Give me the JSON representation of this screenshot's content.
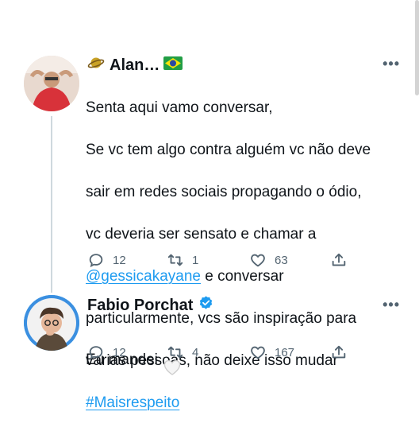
{
  "tweets": [
    {
      "author": "Alan…",
      "body_lines": [
        "Senta aqui vamo conversar,",
        "Se vc tem algo contra alguém vc não deve",
        "sair em redes sociais propagando o ódio,",
        "vc deveria ser sensato e chamar a"
      ],
      "mention": "@gessicakayane",
      "after_mention": " e conversar",
      "body_lines_2": [
        "particularmente, vcs são inspiração para",
        "varias pessoas, não deixe isso mudar"
      ],
      "hashtag": "#Maisrespeito",
      "replies": "12",
      "retweets": "1",
      "likes": "63",
      "icons": [
        "saturn-emoji-icon",
        "brazil-flag-icon"
      ]
    },
    {
      "author": "Fabio Porchat",
      "verified": true,
      "body": "Eu mandei",
      "replies": "12",
      "retweets": "4",
      "likes": "167",
      "icons": [
        "verified-badge-icon",
        "white-heart-icon"
      ]
    }
  ],
  "colors": {
    "link": "#1d9bf0",
    "muted": "#536471",
    "thread": "#cfd9de",
    "verified": "#1d9bf0"
  }
}
